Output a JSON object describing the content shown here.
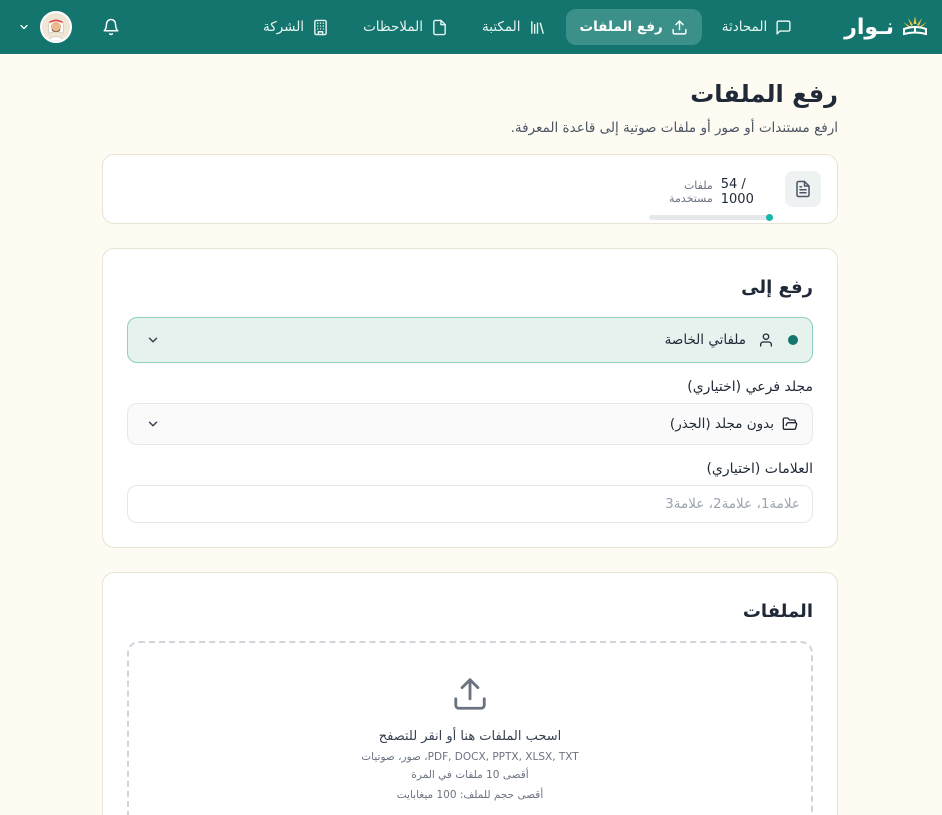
{
  "navbar": {
    "brand": "نـوار",
    "items": [
      {
        "label": "المحادثة",
        "icon": "chat-icon"
      },
      {
        "label": "رفع الملفات",
        "icon": "upload-icon",
        "active": true
      },
      {
        "label": "المكتبة",
        "icon": "library-icon"
      },
      {
        "label": "الملاحظات",
        "icon": "note-icon"
      },
      {
        "label": "الشركة",
        "icon": "building-icon"
      }
    ]
  },
  "page": {
    "title": "رفع الملفات",
    "subtitle": "ارفع مستندات أو صور أو ملفات صوتية إلى قاعدة المعرفة."
  },
  "usage": {
    "count": "54 / 1000",
    "label": "ملفات مستخدمة",
    "fraction": 0.054
  },
  "upload": {
    "title": "رفع إلى",
    "scope": "ملفاتي الخاصة",
    "folder_label": "مجلد فرعي (اختياري)",
    "folder_value": "بدون مجلد (الجذر)",
    "tags_label": "العلامات (اختياري)",
    "tags_placeholder": "علامة1، علامة2، علامة3"
  },
  "files": {
    "title": "الملفات",
    "drop_title": "اسحب الملفات هنا أو انقر للتصفح",
    "formats": "PDF, DOCX, PPTX, XLSX, TXT، صور، صوتيات",
    "max_files": "أقصى 10 ملفات في المرة",
    "max_size": "أقصى حجم للملف: 100 ميغابايت"
  },
  "colors": {
    "navbar": "#13756d",
    "accent": "#14b8a6",
    "background": "#fefbf3"
  }
}
